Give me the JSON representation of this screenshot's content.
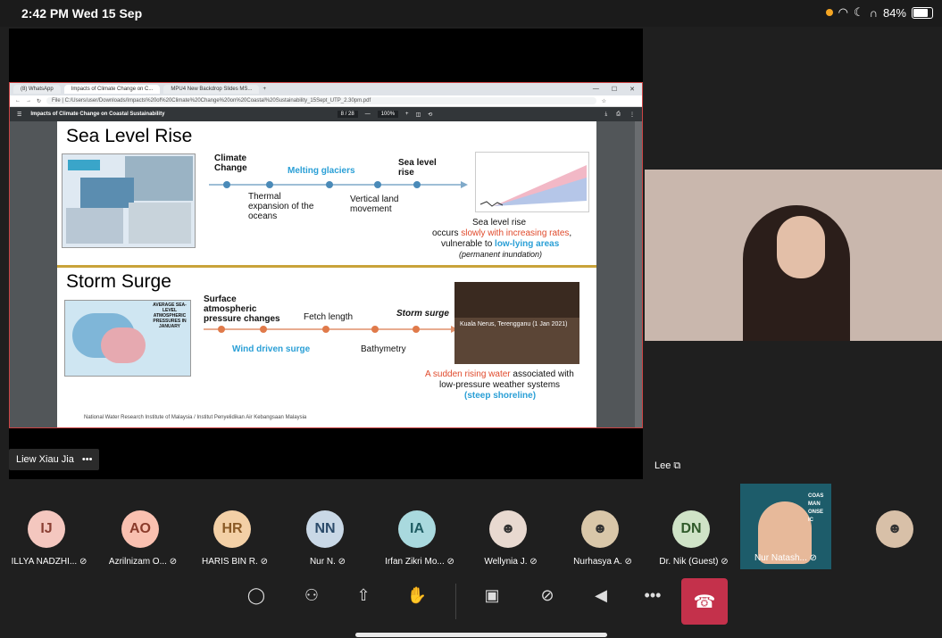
{
  "status": {
    "time": "2:42 PM   Wed 15 Sep",
    "battery": "84%"
  },
  "browser": {
    "tabs": [
      "(8) WhatsApp",
      "Impacts of Climate Change on C...",
      "MPU4 New Backdrop Slides MS..."
    ],
    "new_tab": "+",
    "address": "File  |  C:/Users/user/Downloads/Impacts%20of%20Climate%20Change%20on%20Coastal%20Sustainability_15Sept_UTP_2.30pm.pdf",
    "pdf_title": "Impacts of Climate Change on Coastal Sustainability",
    "page": "8 / 28",
    "zoom": "100%"
  },
  "slide": {
    "sea_title": "Sea Level Rise",
    "sea_labels": {
      "climate_change": "Climate Change",
      "melting_glaciers": "Melting glaciers",
      "sea_level_rise": "Sea level rise",
      "thermal": "Thermal expansion of the oceans",
      "vertical": "Vertical land movement"
    },
    "sea_caption": {
      "line1": "Sea level rise",
      "occurs": "occurs ",
      "slowly": "slowly with increasing rates",
      "vulnerable": "vulnerable to ",
      "lowlying": "low-lying areas",
      "permanent": "(permanent inundation)"
    },
    "storm_title": "Storm Surge",
    "storm_labels": {
      "surface": "Surface atmospheric pressure changes",
      "fetch": "Fetch length",
      "storm_surge": "Storm surge",
      "wind": "Wind driven surge",
      "bathymetry": "Bathymetry"
    },
    "map_caption": "AVERAGE SEA-LEVEL ATMOSPHERIC PRESSURES IN JANUARY",
    "photo_caption": "Kuala Nerus, Terengganu (1 Jan 2021)",
    "storm_caption": {
      "sudden": "A sudden rising water",
      "associated": " associated with",
      "lowpressure": "low-pressure weather systems",
      "steep": "(steep shoreline)"
    },
    "footer": "National Water Research Institute of Malaysia / Institut Penyelidikan Air Kebangsaan Malaysia"
  },
  "meeting": {
    "presenter_label": "Liew Xiau Jia",
    "more": "•••",
    "lee_label": "Lee",
    "participants": [
      {
        "initials": "IJ",
        "name": "ILLYA NADZHI...",
        "color": "#f4c7bf"
      },
      {
        "initials": "AO",
        "name": "Azrilnizam O...",
        "color": "#f9c0b0"
      },
      {
        "initials": "HR",
        "name": "HARIS BIN R.",
        "color": "#f3d0a6"
      },
      {
        "initials": "NN",
        "name": "Nur N.",
        "color": "#c9d8e6"
      },
      {
        "initials": "IA",
        "name": "Irfan Zikri Mo...",
        "color": "#a9d9de"
      },
      {
        "initials": "",
        "name": "Wellynia J.",
        "color": "#e8d9d0"
      },
      {
        "initials": "",
        "name": "Nurhasya A.",
        "color": "#d9c7a9"
      },
      {
        "initials": "DN",
        "name": "Dr. Nik (Guest)",
        "color": "#cfe3c7"
      },
      {
        "initials": "",
        "name": "Nur Natash...",
        "color": "#1d5c6a"
      },
      {
        "initials": "",
        "name": "",
        "color": "#d8c0a8"
      }
    ],
    "nur_tile_text": "COAS MAN ONSE IC"
  }
}
